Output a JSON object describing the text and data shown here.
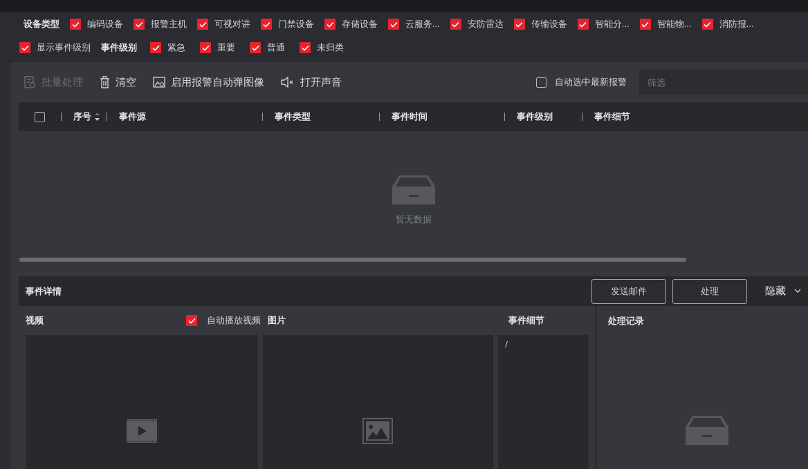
{
  "device_filter": {
    "label": "设备类型",
    "items": [
      {
        "label": "编码设备",
        "checked": true
      },
      {
        "label": "报警主机",
        "checked": true
      },
      {
        "label": "可视对讲",
        "checked": true
      },
      {
        "label": "门禁设备",
        "checked": true
      },
      {
        "label": "存储设备",
        "checked": true
      },
      {
        "label": "云服务...",
        "checked": true
      },
      {
        "label": "安防雷达",
        "checked": true
      },
      {
        "label": "传输设备",
        "checked": true
      },
      {
        "label": "智能分...",
        "checked": true
      },
      {
        "label": "智能物...",
        "checked": true
      },
      {
        "label": "消防报...",
        "checked": true
      }
    ]
  },
  "show_level": {
    "label": "显示事件级别",
    "checked": true
  },
  "level_filter": {
    "label": "事件级别",
    "items": [
      {
        "label": "紧急",
        "checked": true
      },
      {
        "label": "重要",
        "checked": true
      },
      {
        "label": "普通",
        "checked": true
      },
      {
        "label": "未归类",
        "checked": true
      }
    ]
  },
  "toolbar": {
    "buttons": [
      {
        "label": "批量处理",
        "kind": "batch",
        "disabled": true
      },
      {
        "label": "清空",
        "kind": "clear",
        "disabled": false
      },
      {
        "label": "启用报警自动弹图像",
        "kind": "popup",
        "disabled": false
      },
      {
        "label": "打开声音",
        "kind": "sound",
        "disabled": false
      }
    ],
    "auto_select": {
      "label": "自动选中最新报警",
      "checked": false
    },
    "filter": {
      "placeholder": "筛选"
    }
  },
  "table": {
    "select_all": {
      "checked": false
    },
    "columns": [
      {
        "label": "序号",
        "sortable": true
      },
      {
        "label": "事件源",
        "sortable": false
      },
      {
        "label": "事件类型",
        "sortable": false
      },
      {
        "label": "事件时间",
        "sortable": false
      },
      {
        "label": "事件级别",
        "sortable": false
      },
      {
        "label": "事件细节",
        "sortable": false
      }
    ],
    "empty_text": "暂无数据"
  },
  "details": {
    "title": "事件详情",
    "buttons": [
      "发送邮件",
      "处理"
    ],
    "hide": "隐藏",
    "video": {
      "label": "视频",
      "auto_play": {
        "label": "自动播放视频",
        "checked": true
      }
    },
    "image": {
      "label": "图片"
    },
    "detail": {
      "label": "事件细节",
      "value": "/"
    },
    "record": {
      "label": "处理记录"
    }
  }
}
